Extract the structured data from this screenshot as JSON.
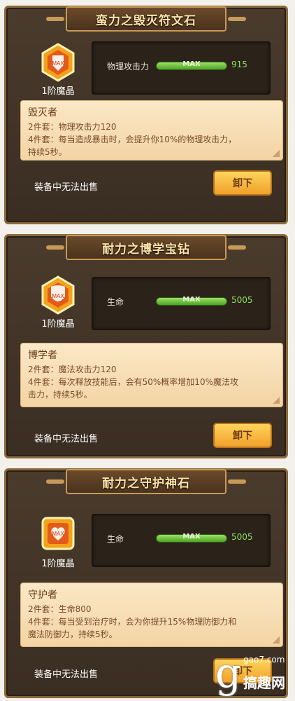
{
  "panels": [
    {
      "title": "蛮力之毁灭符文石",
      "gem_label": "1阶魔晶",
      "gem_badge": "MAX",
      "gem_icon": "sword-shield-icon",
      "stat_name": "物理攻击力",
      "bar_text": "MAX",
      "stat_value": "915",
      "set_name": "毁灭者",
      "set2": "2件套：物理攻击力120",
      "set4a": "4件套：每当造成暴击时，会提升你10%的物理攻击力，",
      "set4b": "持续5秒。",
      "unsellable": "装备中无法出售",
      "button": "卸下"
    },
    {
      "title": "耐力之博学宝钻",
      "gem_label": "1阶魔晶",
      "gem_badge": "MAX",
      "gem_icon": "shield-icon",
      "stat_name": "生命",
      "bar_text": "MAX",
      "stat_value": "5005",
      "set_name": "博学者",
      "set2": "2件套：魔法攻击力120",
      "set4a": "4件套：每次释放技能后，会有50%概率增加10%魔法攻",
      "set4b": "击力，持续5秒。",
      "unsellable": "装备中无法出售",
      "button": "卸下"
    },
    {
      "title": "耐力之守护神石",
      "gem_label": "1阶魔晶",
      "gem_badge": "MAX",
      "gem_icon": "heart-icon",
      "stat_name": "生命",
      "bar_text": "MAX",
      "stat_value": "5005",
      "set_name": "守护者",
      "set2": "2件套：生命800",
      "set4a": "4件套：每当受到治疗时，会为你提升15%物理防御力和",
      "set4b": "魔法防御力，持续5秒。",
      "unsellable": "装备中无法出售",
      "button": "卸下"
    }
  ],
  "watermark": {
    "url": "gao7.com",
    "name": "搞趣网"
  }
}
